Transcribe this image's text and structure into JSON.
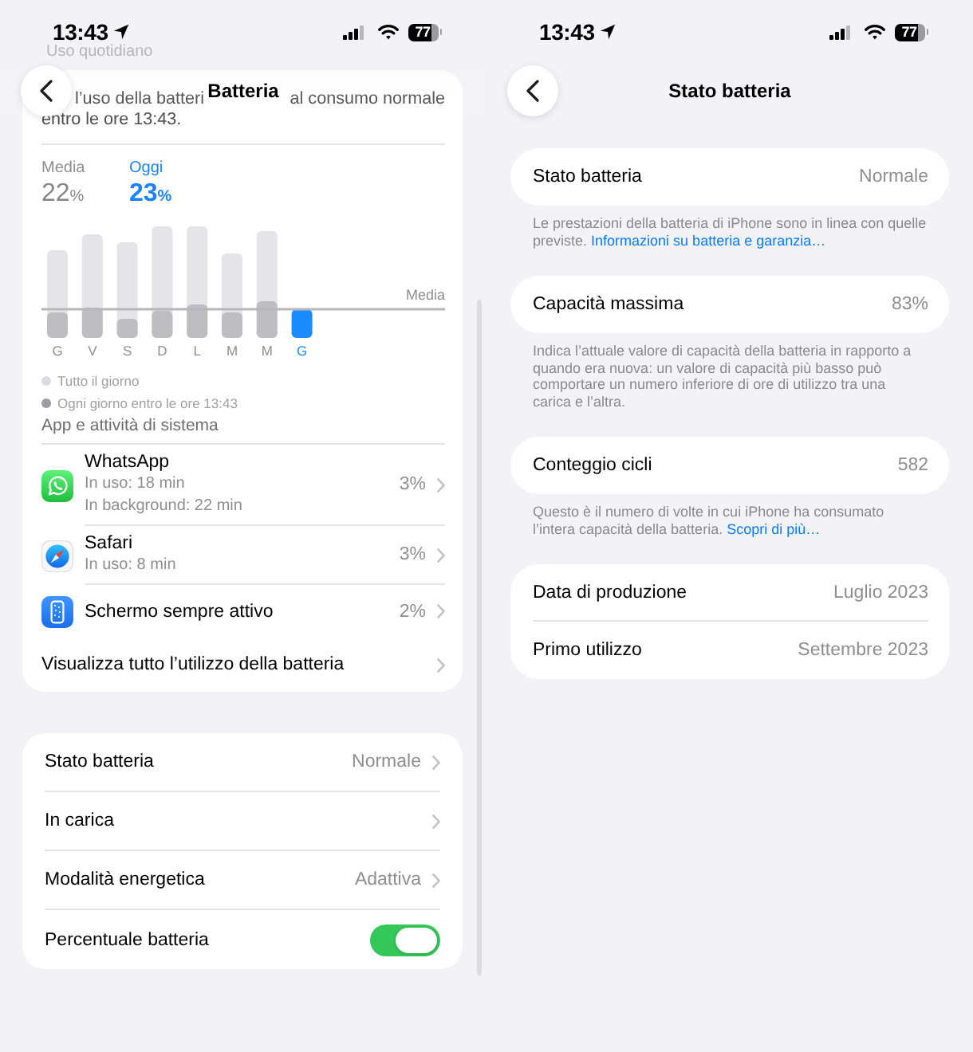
{
  "battery_screen": {
    "status_bar": {
      "time": "13:43",
      "battery": "77"
    },
    "navigation": {
      "title": "Batteria"
    },
    "section_header": "Uso quotidiano",
    "summary": [
      "l’uso della batteri",
      "al consumo normale",
      "entro le ore 13:43."
    ],
    "stats": [
      {
        "kind": "average",
        "label": "Media",
        "value": "22",
        "unit": "%"
      },
      {
        "kind": "today",
        "label": "Oggi",
        "value": "23",
        "unit": "%"
      }
    ],
    "chart": {
      "average_label": "Media",
      "days": [
        {
          "label": "G",
          "selected": false
        },
        {
          "label": "V",
          "selected": false
        },
        {
          "label": "S",
          "selected": false
        },
        {
          "label": "D",
          "selected": false
        },
        {
          "label": "L",
          "selected": false
        },
        {
          "label": "M",
          "selected": false
        },
        {
          "label": "M",
          "selected": false
        },
        {
          "label": "G",
          "selected": true
        }
      ]
    },
    "legend": [
      {
        "label": "Tutto il giorno",
        "color": "#dcdce0"
      },
      {
        "label": "Ogni giorno entro le ore 13:43",
        "color": "#9c9ca1"
      }
    ],
    "apps_header": "App e attività di sistema",
    "apps": [
      {
        "kind": "messaging",
        "name": "WhatsApp",
        "details": [
          "In uso: 18 min",
          "In background: 22 min"
        ],
        "percent": "3%"
      },
      {
        "kind": "browser",
        "name": "Safari",
        "details": [
          "In uso: 8 min"
        ],
        "percent": "3%"
      },
      {
        "kind": "display",
        "name": "Schermo sempre attivo",
        "percent": "2%"
      }
    ],
    "show_all": "Visualizza tutto l’utilizzo della batteria",
    "settings": [
      {
        "kind": "link",
        "label": "Stato batteria",
        "value": "Normale"
      },
      {
        "kind": "link",
        "label": "In carica"
      },
      {
        "kind": "link",
        "label": "Modalità energetica",
        "value": "Adattiva"
      },
      {
        "kind": "toggle",
        "label": "Percentuale batteria",
        "on": true
      }
    ]
  },
  "health_screen": {
    "status_bar": {
      "time": "13:43",
      "battery": "77"
    },
    "navigation": {
      "title": "Stato batteria"
    },
    "groups": [
      {
        "rows": [
          {
            "label": "Stato batteria",
            "value": "Normale"
          }
        ],
        "footer": {
          "text": "Le prestazioni della batteria di iPhone sono in linea con quelle previste.",
          "link": "Informazioni su batteria e garanzia…"
        }
      },
      {
        "rows": [
          {
            "label": "Capacità massima",
            "value": "83%"
          }
        ],
        "footer": {
          "text": "Indica l’attuale valore di capacità della batteria in rapporto a quando era nuova: un valore di capacità più basso può comportare un numero inferiore di ore di utilizzo tra una carica e l’altra."
        }
      },
      {
        "rows": [
          {
            "label": "Conteggio cicli",
            "value": "582"
          }
        ],
        "footer": {
          "text": "Questo è il numero di volte in cui iPhone ha consumato l’intera capacità della batteria.",
          "link": "Scopri di più…"
        }
      },
      {
        "rows": [
          {
            "label": "Data di produzione",
            "value": "Luglio 2023"
          },
          {
            "label": "Primo utilizzo",
            "value": "Settembre 2023"
          }
        ]
      }
    ]
  }
}
